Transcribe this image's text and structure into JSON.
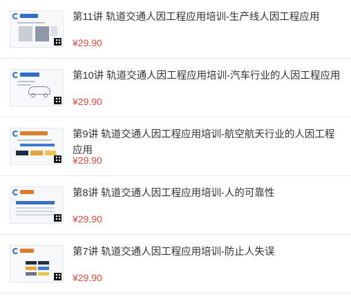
{
  "items": [
    {
      "title": "第11讲 轨道交通人因工程应用培训-生产线人因工程应用",
      "price": "¥29.90",
      "thumb_icon": "slide-thumbnail-production-line"
    },
    {
      "title": "第10讲 轨道交通人因工程应用培训-汽车行业的人因工程应用",
      "price": "¥29.90",
      "thumb_icon": "slide-thumbnail-automotive"
    },
    {
      "title": "第9讲 轨道交通人因工程应用培训-航空航天行业的人因工程应用",
      "price": "¥29.90",
      "thumb_icon": "slide-thumbnail-aerospace"
    },
    {
      "title": "第8讲 轨道交通人因工程应用培训-人的可靠性",
      "price": "¥29.90",
      "thumb_icon": "slide-thumbnail-reliability"
    },
    {
      "title": "第7讲 轨道交通人因工程应用培训-防止人失误",
      "price": "¥29.90",
      "thumb_icon": "slide-thumbnail-error-prevention"
    }
  ],
  "colors": {
    "price": "#e8473b",
    "title": "#333333",
    "divider": "#ececec",
    "thumb_accent": "#2f6fc7"
  }
}
